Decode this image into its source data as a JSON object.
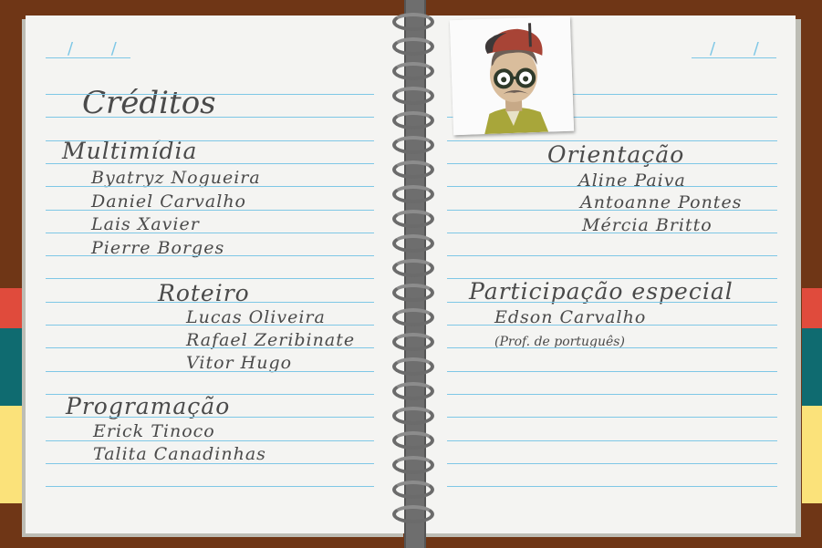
{
  "notebook": {
    "left_page": {
      "date_mark": "/ /",
      "title": "Créditos",
      "sections": [
        {
          "heading": "Multimídia",
          "names": [
            "Byatryz Nogueira",
            "Daniel Carvalho",
            "Lais Xavier",
            "Pierre Borges"
          ]
        },
        {
          "heading": "Roteiro",
          "names": [
            "Lucas Oliveira",
            "Rafael Zeribinate",
            "Vitor Hugo"
          ]
        },
        {
          "heading": "Programação",
          "names": [
            "Erick Tinoco",
            "Talita Canadinhas"
          ]
        }
      ]
    },
    "right_page": {
      "date_mark": "/ /",
      "photo_icon": "mascot-portrait-icon",
      "sections": [
        {
          "heading": "Orientação",
          "names": [
            "Aline Paiva",
            "Antoanne Pontes",
            "Mércia Britto"
          ]
        },
        {
          "heading": "Participação especial",
          "names": [
            "Edson Carvalho"
          ],
          "note": "(Prof. de português)"
        }
      ]
    }
  },
  "colors": {
    "cover": "#6f3616",
    "page": "#f4f4f2",
    "rule_line": "#7ec7e6",
    "ink": "#4a4a4a",
    "tab_red": "#e04b3c",
    "tab_teal": "#0f6b70",
    "tab_yellow": "#fbe27a"
  }
}
